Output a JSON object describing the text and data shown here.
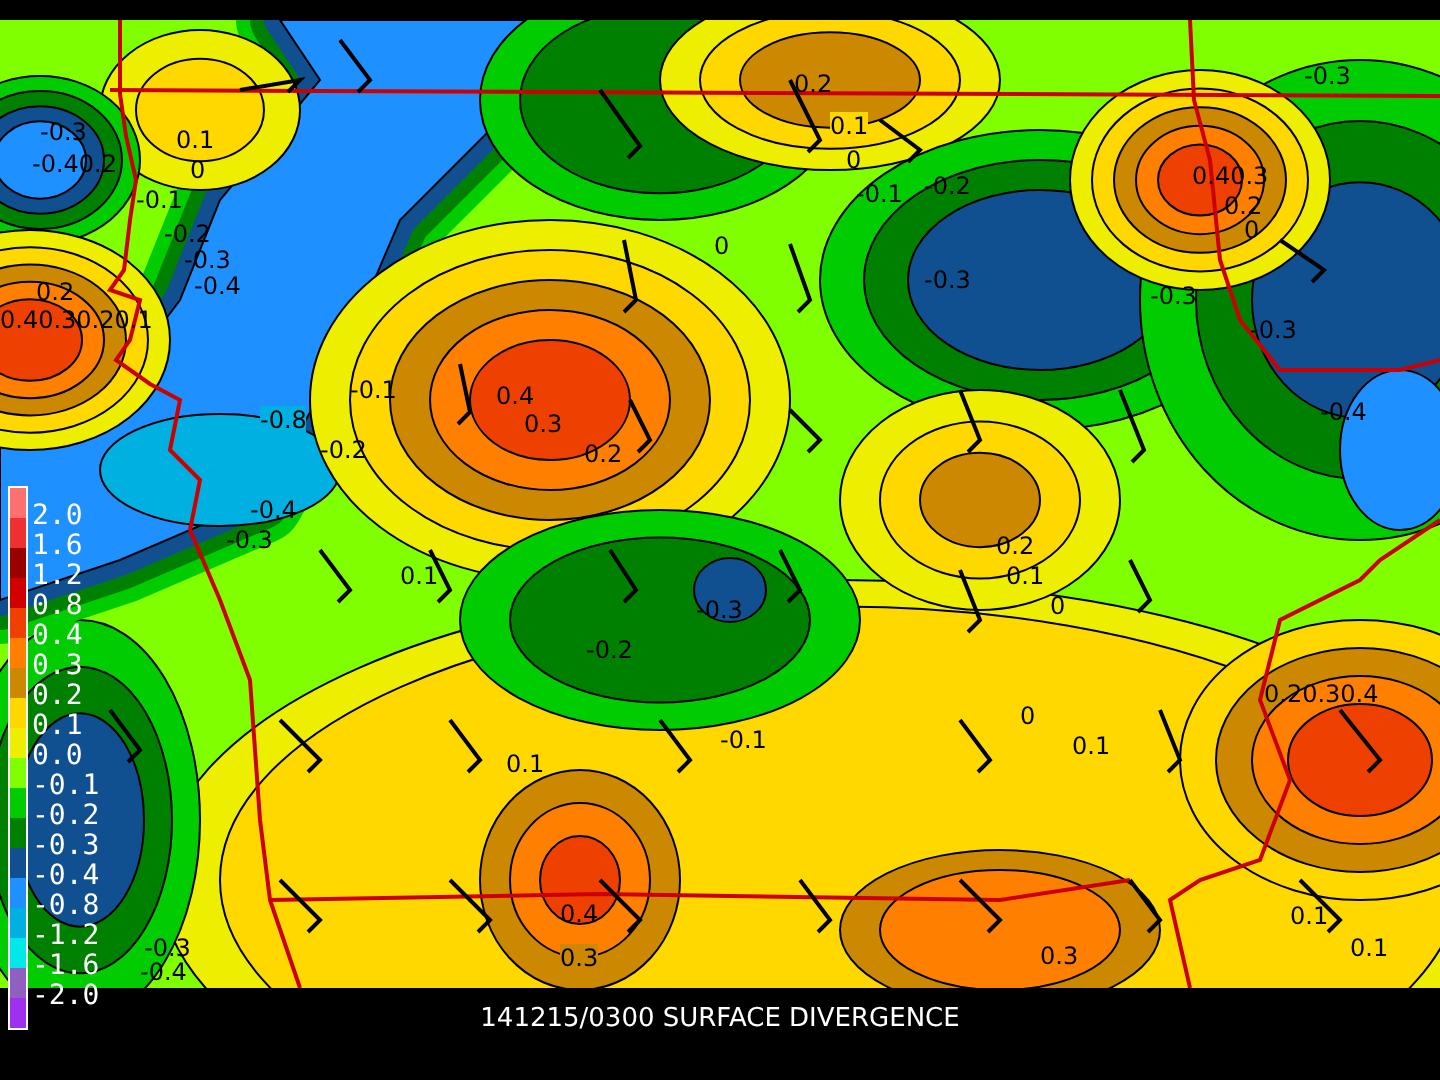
{
  "map": {
    "contour_labels": [
      "0.2",
      "-0.3",
      "-0.3",
      "0.1",
      "0.1",
      "-0.40.2",
      "0",
      "0",
      "0.40.3",
      "-0.1",
      "-0.1",
      "-0.2",
      "0.2",
      "-0.2",
      "0",
      "0",
      "-0.3",
      "0.2",
      "-0.4",
      "-0.3",
      "-0.3",
      "0.40.30.20.1",
      "-0.3",
      "-0.1",
      "0.4",
      "-0.8",
      "0.3",
      "-0.4",
      "-0.2",
      "0.2",
      "-0.4",
      "-0.3",
      "0.2",
      "0.1",
      "0.1",
      "0",
      "-0.3",
      "-0.2",
      "0.20.30.4",
      "0",
      "-0.1",
      "0.1",
      "0.1",
      "0.4",
      "0.1",
      "-0.3",
      "0.3",
      "0.3",
      "0.1",
      "-0.4"
    ]
  },
  "legend": {
    "swatches": [
      {
        "color": "#ff7070"
      },
      {
        "color": "#ee3030"
      },
      {
        "color": "#990000"
      },
      {
        "color": "#d00000"
      },
      {
        "color": "#ee4000"
      },
      {
        "color": "#ff8000"
      },
      {
        "color": "#cc8800"
      },
      {
        "color": "#ffd800"
      },
      {
        "color": "#eeee00"
      },
      {
        "color": "#80ff00"
      },
      {
        "color": "#00cc00"
      },
      {
        "color": "#008000"
      },
      {
        "color": "#105090"
      },
      {
        "color": "#1e90ff"
      },
      {
        "color": "#00b0e0"
      },
      {
        "color": "#00e8e8"
      },
      {
        "color": "#9060c0"
      },
      {
        "color": "#a030f0"
      }
    ],
    "labels": [
      "2.0",
      "1.6",
      "1.2",
      "0.8",
      "0.4",
      "0.3",
      "0.2",
      "0.1",
      "0.0",
      "-0.1",
      "-0.2",
      "-0.3",
      "-0.4",
      "-0.8",
      "-1.2",
      "-1.6",
      "-2.0"
    ]
  },
  "caption": "141215/0300 SURFACE DIVERGENCE"
}
